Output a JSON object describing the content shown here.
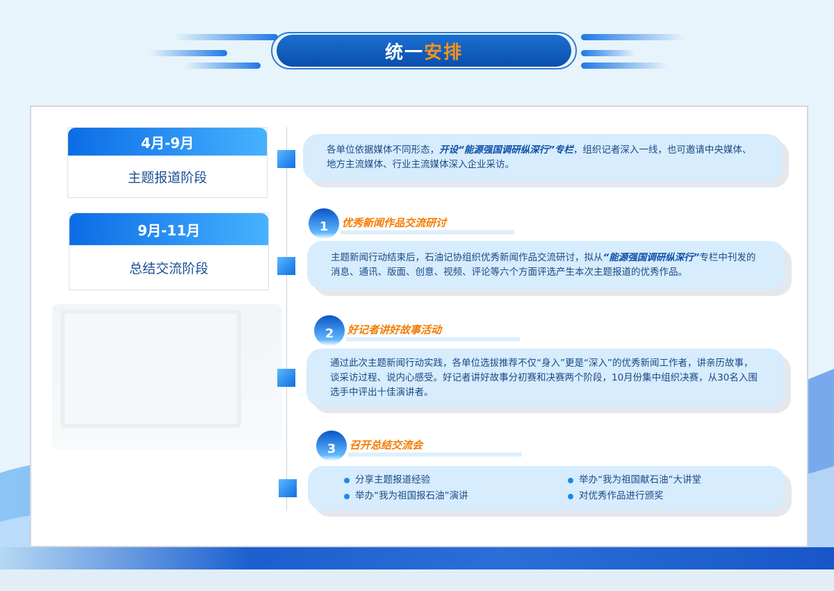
{
  "header": {
    "title_part1": "统一",
    "title_part2": "安排",
    "accent_color": "#f7931e",
    "brand_color": "#0a4fad"
  },
  "stages": [
    {
      "period": "4月-9月",
      "name": "主题报道阶段"
    },
    {
      "period": "9月-11月",
      "name": "总结交流阶段"
    }
  ],
  "intro_card": {
    "text_before": "各单位依据媒体不同形态，",
    "highlight": "开设“能源强国调研纵深行”专栏",
    "text_after": "，组织记者深入一线，也可邀请中央媒体、地方主流媒体、行业主流媒体深入企业采访。"
  },
  "sections": [
    {
      "number": "1",
      "title": "优秀新闻作品交流研讨",
      "text_before": "主题新闻行动结束后，石油记协组织优秀新闻作品交流研讨，拟从",
      "highlight": "“能源强国调研纵深行”",
      "text_after": "专栏中刊发的消息、通讯、版面、创意、视频、评论等六个方面评选产生本次主题报道的优秀作品。"
    },
    {
      "number": "2",
      "title": "好记者讲好故事活动",
      "text": "通过此次主题新闻行动实践，各单位选拔推荐不仅“身入”更是“深入”的优秀新闻工作者，讲亲历故事，谈采访过程、说内心感受。好记者讲好故事分初赛和决赛两个阶段，10月份集中组织决赛，从30名入围选手中评出十佳演讲者。"
    },
    {
      "number": "3",
      "title": "召开总结交流会",
      "bullets": [
        "分享主题报道经验",
        "举办“我为祖国献石油”大讲堂",
        "举办“我为祖国报石油”演讲",
        "对优秀作品进行颁奖"
      ]
    }
  ]
}
